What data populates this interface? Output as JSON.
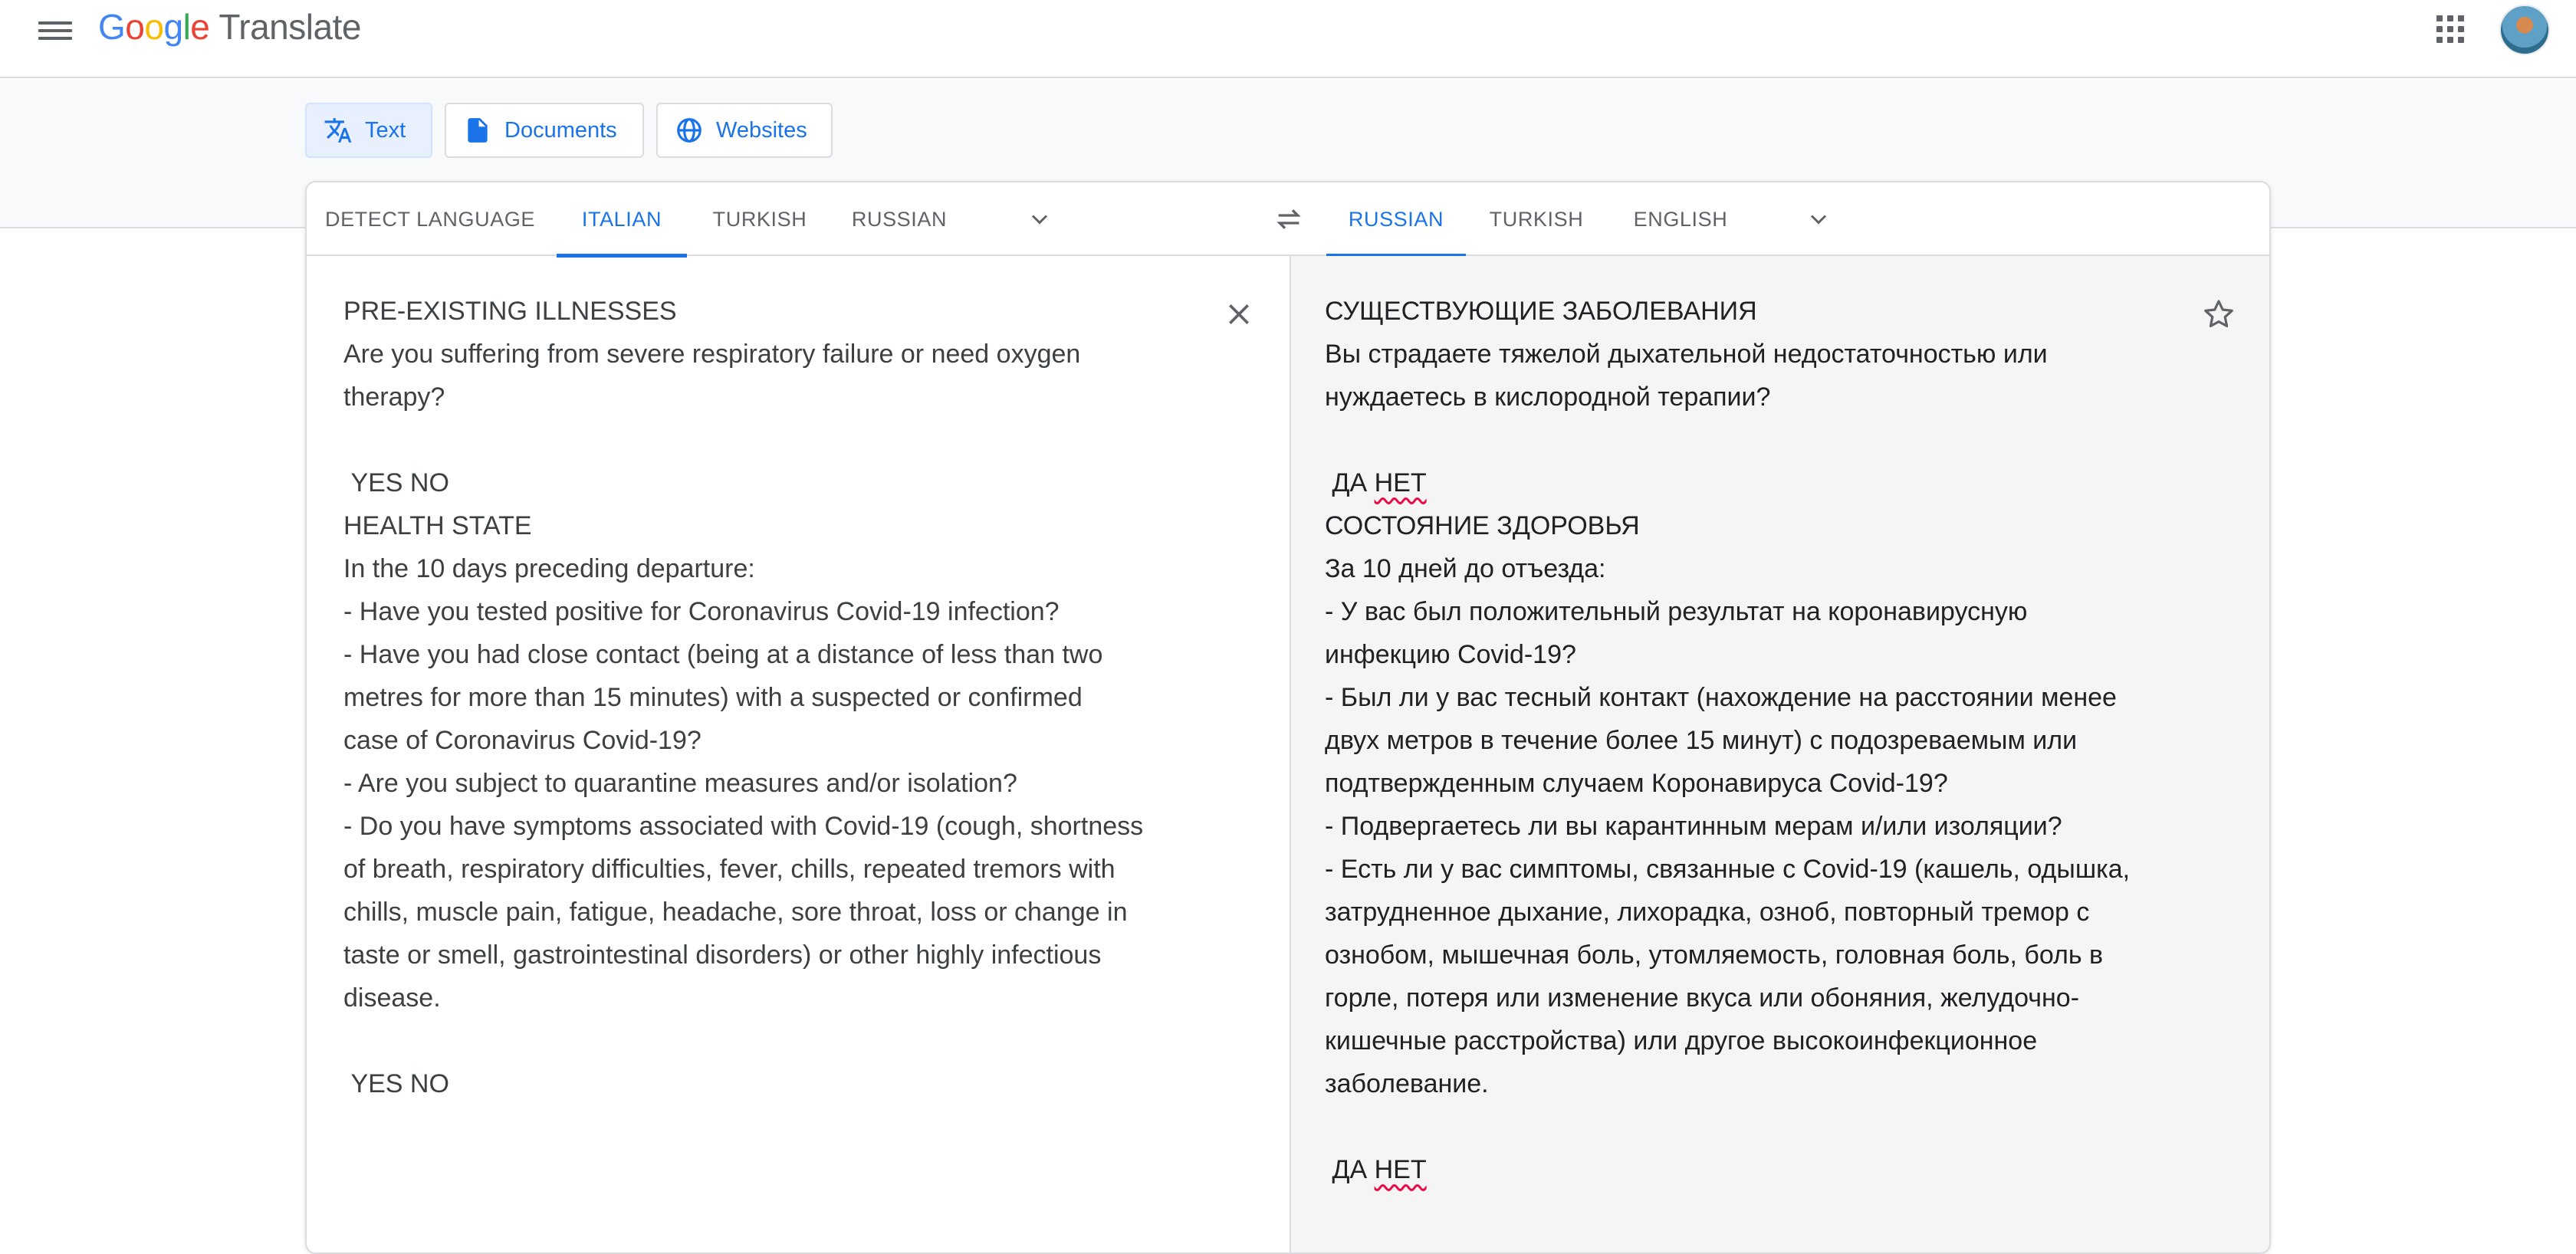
{
  "header": {
    "logo": {
      "g1": "G",
      "o1": "o",
      "o2": "o",
      "g2": "g",
      "l": "l",
      "e": "e",
      "product": "Translate"
    }
  },
  "modes": [
    {
      "label": "Text",
      "icon": "translate-icon",
      "active": true
    },
    {
      "label": "Documents",
      "icon": "document-icon",
      "active": false
    },
    {
      "label": "Websites",
      "icon": "globe-icon",
      "active": false
    }
  ],
  "source_langs": [
    "DETECT LANGUAGE",
    "ITALIAN",
    "TURKISH",
    "RUSSIAN"
  ],
  "target_langs": [
    "RUSSIAN",
    "TURKISH",
    "ENGLISH"
  ],
  "source": {
    "text": "PRE-EXISTING ILLNESSES\nAre you suffering from severe respiratory failure or need oxygen\ntherapy?\n\n YES NO\nHEALTH STATE\nIn the 10 days preceding departure:\n- Have you tested positive for Coronavirus Covid-19 infection?\n- Have you had close contact (being at a distance of less than two\nmetres for more than 15 minutes) with a suspected or confirmed\ncase of Coronavirus Covid-19?\n- Are you subject to quarantine measures and/or isolation?\n- Do you have symptoms associated with Covid-19 (cough, shortness\nof breath, respiratory difficulties, fever, chills, repeated tremors with\nchills, muscle pain, fatigue, headache, sore throat, loss or change in\ntaste or smell, gastrointestinal disorders) or other highly infectious\ndisease.\n\n YES NO"
  },
  "target": {
    "part1": "СУЩЕСТВУЮЩИЕ ЗАБОЛЕВАНИЯ\nВы страдаете тяжелой дыхательной недостаточностью или\nнуждаетесь в кислородной терапии?\n\n ДА ",
    "net1": "НЕТ",
    "part2": "\nСОСТОЯНИЕ ЗДОРОВЬЯ\nЗа 10 дней до отъезда:\n- У вас был положительный результат на коронавирусную\nинфекцию Covid-19?\n- Был ли у вас тесный контакт (нахождение на расстоянии менее\nдвух метров в течение более 15 минут) с подозреваемым или\nподтвержденным случаем Коронавируса Covid-19?\n- Подвергаетесь ли вы карантинным мерам и/или изоляции?\n- Есть ли у вас симптомы, связанные с Covid-19 (кашель, одышка,\nзатрудненное дыхание, лихорадка, озноб, повторный тремор с\nознобом, мышечная боль, утомляемость, головная боль, боль в\nгорле, потеря или изменение вкуса или обоняния, желудочно-\nкишечные расстройства) или другое высокоинфекционное\nзаболевание.\n\n ДА ",
    "net2": "НЕТ"
  },
  "icons": {
    "menu": "menu-icon",
    "apps": "apps-grid-icon",
    "avatar": "avatar",
    "swap": "swap-icon",
    "clear": "close-icon",
    "star": "star-icon",
    "chevron": "chevron-down-icon"
  },
  "colors": {
    "accent": "#1a73e8",
    "tab_active_bg": "#e8f0fe",
    "spell_underline": "#ea0b46"
  }
}
